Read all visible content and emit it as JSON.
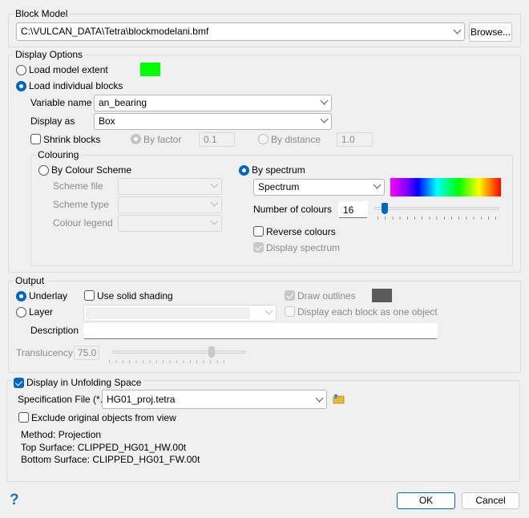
{
  "block_model": {
    "title": "Block Model",
    "file": "C:\\VULCAN_DATA\\Tetra\\blockmodelani.bmf",
    "browse": "Browse..."
  },
  "display_options": {
    "title": "Display Options",
    "load_extent": "Load model extent",
    "extent_color": "#00ff00",
    "load_individual": "Load individual blocks",
    "variable_label": "Variable name",
    "variable_value": "an_bearing",
    "display_as_label": "Display as",
    "display_as_value": "Box",
    "shrink": "Shrink blocks",
    "by_factor": "By factor",
    "factor_value": "0.1",
    "by_distance": "By distance",
    "distance_value": "1.0"
  },
  "colouring": {
    "title": "Colouring",
    "by_scheme": "By Colour Scheme",
    "scheme_file": "Scheme file",
    "scheme_type": "Scheme type",
    "colour_legend": "Colour legend",
    "by_spectrum": "By spectrum",
    "spectrum_value": "Spectrum",
    "num_colours_label": "Number of colours",
    "num_colours": "16",
    "reverse": "Reverse colours",
    "display_spectrum": "Display spectrum"
  },
  "output": {
    "title": "Output",
    "underlay": "Underlay",
    "solid_shading": "Use solid shading",
    "draw_outlines": "Draw outlines",
    "outline_color": "#5a5a5a",
    "layer": "Layer",
    "layer_value": "",
    "each_block": "Display each block as one object",
    "description_label": "Description",
    "description_value": "",
    "translucency_label": "Translucency",
    "translucency": "75.0"
  },
  "unfolding": {
    "title": "Display in Unfolding Space",
    "spec_label": "Specification File (*.tetra)",
    "spec_value": "HG01_proj.tetra",
    "exclude": "Exclude original objects from view",
    "method": "Method: Projection",
    "top": "Top Surface: CLIPPED_HG01_HW.00t",
    "bottom": "Bottom Surface: CLIPPED_HG01_FW.00t"
  },
  "footer": {
    "help": "?",
    "ok": "OK",
    "cancel": "Cancel"
  }
}
